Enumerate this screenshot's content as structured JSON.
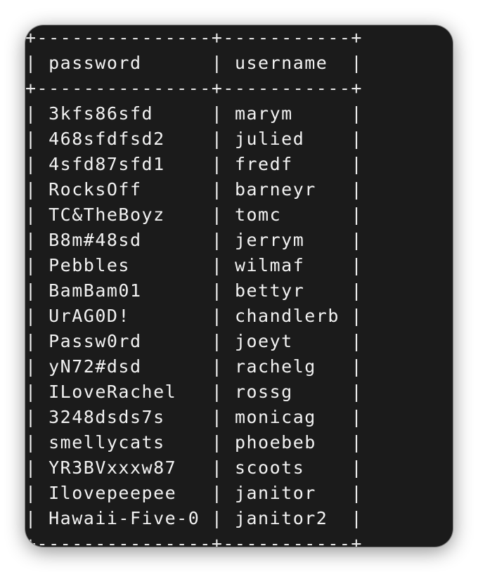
{
  "table": {
    "columns": [
      "password",
      "username"
    ],
    "rows": [
      [
        "3kfs86sfd",
        "marym"
      ],
      [
        "468sfdfsd2",
        "julied"
      ],
      [
        "4sfd87sfd1",
        "fredf"
      ],
      [
        "RocksOff",
        "barneyr"
      ],
      [
        "TC&TheBoyz",
        "tomc"
      ],
      [
        "B8m#48sd",
        "jerrym"
      ],
      [
        "Pebbles",
        "wilmaf"
      ],
      [
        "BamBam01",
        "bettyr"
      ],
      [
        "UrAG0D!",
        "chandlerb"
      ],
      [
        "Passw0rd",
        "joeyt"
      ],
      [
        "yN72#dsd",
        "rachelg"
      ],
      [
        "ILoveRachel",
        "rossg"
      ],
      [
        "3248dsds7s",
        "monicag"
      ],
      [
        "smellycats",
        "phoebeb"
      ],
      [
        "YR3BVxxxw87",
        "scoots"
      ],
      [
        "Ilovepeepee",
        "janitor"
      ],
      [
        "Hawaii-Five-0",
        "janitor2"
      ]
    ]
  }
}
